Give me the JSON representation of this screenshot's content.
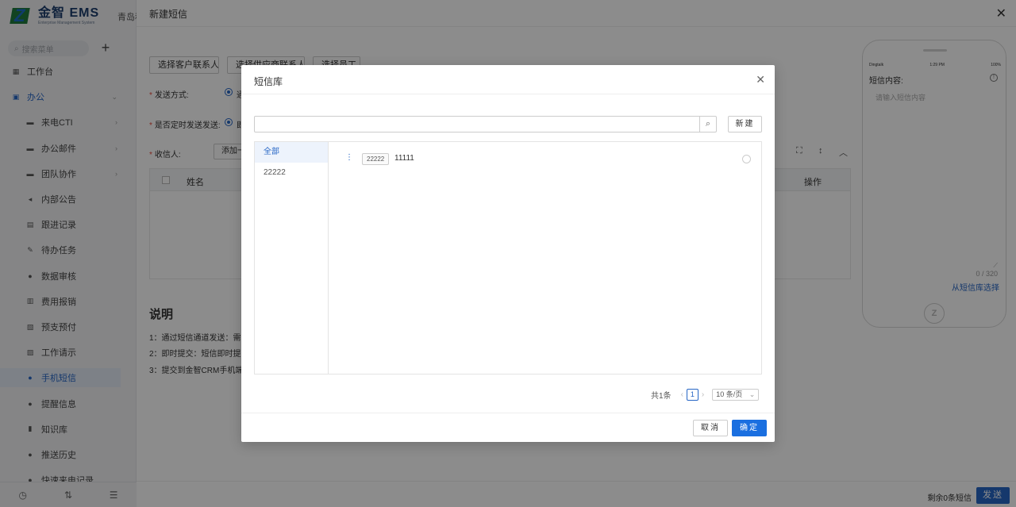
{
  "app": {
    "logo_text": "金智 EMS",
    "logo_subtitle": "Enterprise Management System",
    "company_short": "青岛科"
  },
  "sidebar": {
    "search_placeholder": "搜索菜单",
    "search_icon": "search-icon",
    "add_icon": "plus-icon",
    "items": [
      {
        "label": "工作台",
        "icon": "dashboard-icon",
        "level": "top"
      },
      {
        "label": "办公",
        "icon": "office-icon",
        "level": "group"
      },
      {
        "label": "来电CTI",
        "icon": "folder-icon",
        "level": "sub"
      },
      {
        "label": "办公邮件",
        "icon": "folder-icon",
        "level": "sub"
      },
      {
        "label": "团队协作",
        "icon": "folder-icon",
        "level": "sub"
      },
      {
        "label": "内部公告",
        "icon": "megaphone-icon",
        "level": "sub"
      },
      {
        "label": "跟进记录",
        "icon": "note-icon",
        "level": "sub"
      },
      {
        "label": "待办任务",
        "icon": "pin-icon",
        "level": "sub"
      },
      {
        "label": "数据审核",
        "icon": "user-icon",
        "level": "sub"
      },
      {
        "label": "费用报销",
        "icon": "receipt-icon",
        "level": "sub"
      },
      {
        "label": "预支预付",
        "icon": "wallet-icon",
        "level": "sub"
      },
      {
        "label": "工作请示",
        "icon": "doc-icon",
        "level": "sub"
      },
      {
        "label": "手机短信",
        "icon": "chat-icon",
        "level": "sub",
        "active": true
      },
      {
        "label": "提醒信息",
        "icon": "bell-icon",
        "level": "sub"
      },
      {
        "label": "知识库",
        "icon": "book-icon",
        "level": "sub"
      },
      {
        "label": "推送历史",
        "icon": "history-icon",
        "level": "sub"
      },
      {
        "label": "快速来电记录",
        "icon": "phone-icon",
        "level": "sub"
      }
    ],
    "footer_icons": [
      "clock-icon",
      "filter-icon",
      "list-icon"
    ]
  },
  "drawer": {
    "title": "新建短信",
    "close_icon": "close-icon",
    "toolbar": {
      "btn_customer": "选择客户联系人",
      "btn_supplier": "选择供应商联系人",
      "btn_employee": "选择员工"
    },
    "send_mode_label": "发送方式:",
    "send_mode_value": "通",
    "timing_label": "是否定时发送发送:",
    "timing_value": "即",
    "recipient_label": "收信人:",
    "add_recipient": "添加一",
    "table": {
      "col_name": "姓名",
      "col_op": "操作"
    },
    "explain_title": "说明",
    "explain_lines": [
      "1：通过短信通道发送：需要",
      "2：即时提交：短信即时提交",
      "3：提交到金智CRM手机端："
    ],
    "bottom": {
      "remain": "剩余0条短信",
      "send": "发送"
    }
  },
  "phone": {
    "status_left": "Dingtalk",
    "status_time": "1:29 PM",
    "status_right": "100%",
    "content_label": "短信内容:",
    "placeholder": "请输入短信内容",
    "counter": "0 / 320",
    "from_library": "从短信库选择"
  },
  "modal": {
    "title": "短信库",
    "close_icon": "close-icon",
    "search_placeholder": "",
    "new_button": "新建",
    "categories": [
      {
        "label": "全部",
        "active": true
      },
      {
        "label": "22222",
        "active": false
      }
    ],
    "items": [
      {
        "tag": "22222",
        "text": "11111",
        "selected": false
      }
    ],
    "pager": {
      "total": "共1条",
      "current": "1",
      "page_size": "10 条/页"
    },
    "cancel": "取消",
    "ok": "确定"
  },
  "colors": {
    "accent": "#2766c5",
    "primary_button": "#1a6fe0",
    "required": "#e74c3c"
  }
}
